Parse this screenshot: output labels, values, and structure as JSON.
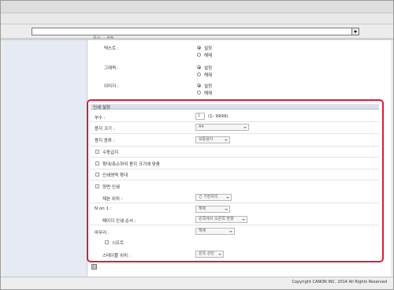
{
  "header": {
    "cut_off_label": "문서 ··· 설정"
  },
  "print_types": [
    {
      "label": "텍스트 :",
      "opt1": "설정",
      "opt2": "해제"
    },
    {
      "label": "그래픽 :",
      "opt1": "설정",
      "opt2": "해제"
    },
    {
      "label": "이미지 :",
      "opt1": "설정",
      "opt2": "해제"
    }
  ],
  "section": {
    "title": "인쇄 설정"
  },
  "copies": {
    "label": "부수 :",
    "value": "1",
    "range": "(1- 9999)"
  },
  "paper_size": {
    "label": "용지 크기 :",
    "value": "A4"
  },
  "paper_type": {
    "label": "용지 종류 :",
    "value": "보통용지"
  },
  "checks": {
    "manual_feed": "수동급지",
    "fit_to_paper": "확대/축소하여 용지 크기에 맞춤",
    "enlarge_print_area": "인쇄영역 확대",
    "duplex": "양면 인쇄"
  },
  "binding": {
    "label": "제본 위치 :",
    "value": "긴 가장자리"
  },
  "n_on_1": {
    "label": "N on 1 :",
    "value": "해제"
  },
  "page_order": {
    "label": "페이지 인쇄 순서 :",
    "value": "왼쪽에서 오른쪽 방향"
  },
  "finishing": {
    "label": "마무리 :",
    "value": "해제"
  },
  "shift": {
    "label": "시프트"
  },
  "staple": {
    "label": "스테이플 위치 :",
    "value": "왼쪽 상단"
  },
  "status": {
    "copyright": "Copyright CANON INC. 2014 All Rights Reserved"
  },
  "colors": {
    "highlight": "#d4213a",
    "section_bg": "#dde0e6",
    "left_pane": "#e6ebf3"
  }
}
